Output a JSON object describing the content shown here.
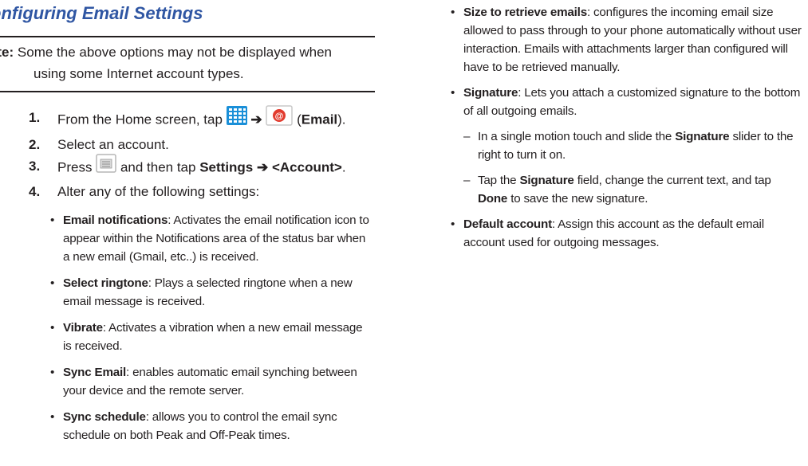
{
  "heading": "onfiguring Email Settings",
  "note": {
    "label": "ote:",
    "line1": " Some the above options may not be displayed when",
    "line2": "using some Internet account types."
  },
  "steps": [
    {
      "num": "1.",
      "pre": "From the Home screen, tap",
      "arrow": "➔",
      "paren_open": "(",
      "bold": "Email",
      "paren_close": ")."
    },
    {
      "num": "2.",
      "text": "Select an account."
    },
    {
      "num": "3.",
      "pre": "Press",
      "mid": " and then tap ",
      "bold1": "Settings",
      "arrow": " ➔ ",
      "bold2": "<Account>",
      "end": "."
    },
    {
      "num": "4.",
      "text": "Alter any of the following settings:"
    }
  ],
  "left_bullets": [
    {
      "term": "Email notifications",
      "desc": ": Activates the email notification icon to appear within the Notifications area of the status bar when a new email (Gmail, etc..) is received."
    },
    {
      "term": "Select ringtone",
      "desc": ": Plays a selected ringtone when a new email message is received."
    },
    {
      "term": "Vibrate",
      "desc": ": Activates a vibration when a new email message is received."
    },
    {
      "term": "Sync Email",
      "desc": ": enables automatic email synching between your device and the remote server."
    },
    {
      "term": "Sync schedule",
      "desc": ": allows you to control the email sync schedule on both Peak and Off-Peak times."
    }
  ],
  "right_items": {
    "size": {
      "term": "Size to retrieve emails",
      "desc": ": configures the incoming email size allowed to pass through to your phone automatically without user interaction. Emails with attachments larger than configured will have to be retrieved manually."
    },
    "signature": {
      "term": "Signature",
      "desc": ": Lets you attach a customized signature to the bottom of all outgoing emails."
    },
    "sub1": {
      "pre": "In a single motion touch and slide the ",
      "bold": "Signature",
      "post": " slider to the right to turn it on."
    },
    "sub2": {
      "pre": "Tap the ",
      "bold": "Signature",
      "mid": " field, change the current text, and tap ",
      "bold2": "Done",
      "post": " to save the new signature."
    },
    "default": {
      "term": "Default account",
      "desc": ": Assign this account as the default email account used for outgoing messages."
    }
  },
  "glyphs": {
    "bullet": "•",
    "dash": "–"
  },
  "icons": [
    "apps-grid-icon",
    "email-app-icon",
    "menu-key-icon"
  ],
  "colors": {
    "heading": "#2f56a3",
    "apps_icon": "#1a8fd8",
    "email_icon": "#e23b2e",
    "text": "#231f20"
  }
}
